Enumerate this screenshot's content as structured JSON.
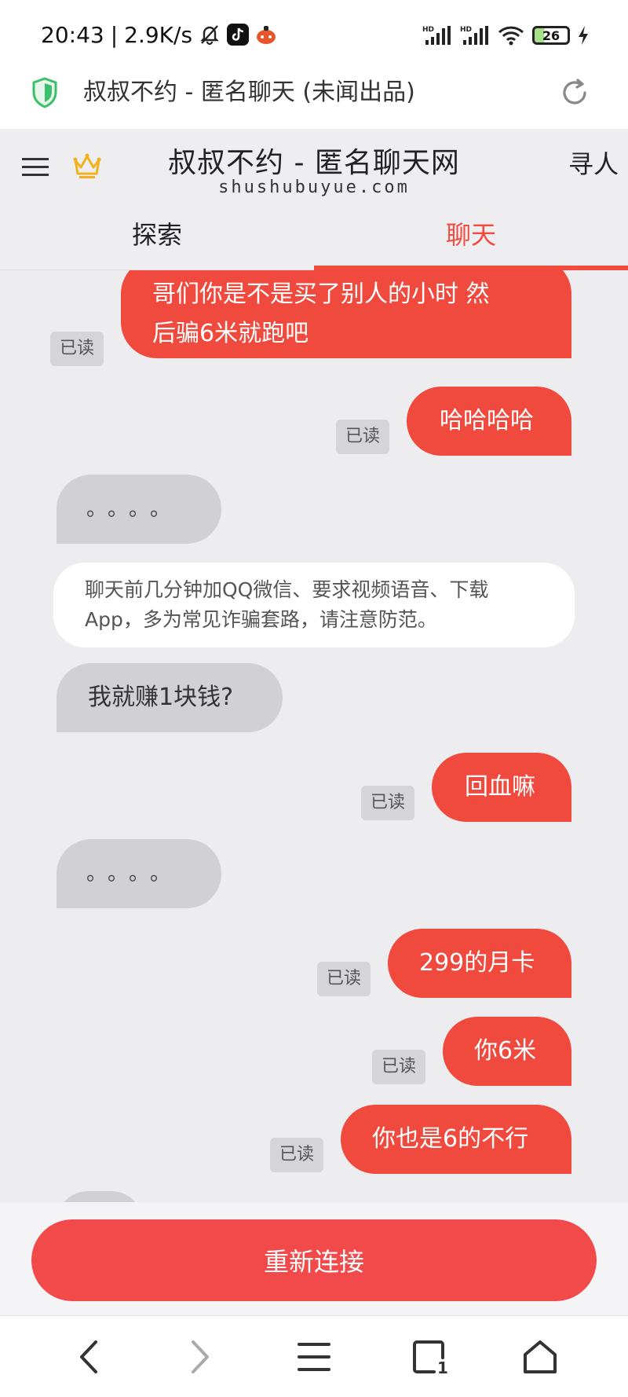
{
  "status_bar": {
    "time": "20:43",
    "separator": "|",
    "net_speed": "2.9K/s",
    "battery": "26",
    "icons": [
      "mute-bell-icon",
      "tiktok-icon",
      "app-icon",
      "hd-signal-icon",
      "hd-signal-icon",
      "wifi-icon",
      "battery-icon",
      "charging-icon"
    ]
  },
  "browser": {
    "title": "叔叔不约 - 匿名聊天 (未闻出品)",
    "icons": [
      "shield-icon",
      "reload-icon"
    ]
  },
  "site": {
    "title": "叔叔不约 - 匿名聊天网",
    "domain": "shushubuyue.com",
    "find_people": "寻人",
    "tabs": [
      {
        "label": "探索",
        "active": false
      },
      {
        "label": "聊天",
        "active": true
      }
    ],
    "accent": "#f24a3e",
    "crown_color": "#f2b21b"
  },
  "chat": {
    "read_label": "已读",
    "messages": [
      {
        "side": "out",
        "lines": [
          "哥们你是不是买了别人的小时 然",
          "后骗6米就跑吧"
        ],
        "read": true
      },
      {
        "side": "out",
        "lines": [
          "哈哈哈哈"
        ],
        "read": true
      },
      {
        "side": "in",
        "lines": [
          "。。。。"
        ]
      },
      {
        "side": "notice",
        "lines": [
          "聊天前几分钟加QQ微信、要求视频语音、下载",
          "App，多为常见诈骗套路，请注意防范。"
        ]
      },
      {
        "side": "in",
        "lines": [
          "我就赚1块钱?"
        ]
      },
      {
        "side": "out",
        "lines": [
          "回血嘛"
        ],
        "read": true
      },
      {
        "side": "in",
        "lines": [
          "。。。。"
        ]
      },
      {
        "side": "out",
        "lines": [
          "299的月卡"
        ],
        "read": true
      },
      {
        "side": "out",
        "lines": [
          "你6米"
        ],
        "read": true
      },
      {
        "side": "out",
        "lines": [
          "你也是6的不行"
        ],
        "read": true
      }
    ]
  },
  "bottom": {
    "reconnect_label": "重新连接"
  },
  "nav_bar": {
    "tab_count": "1",
    "icons": [
      "back-icon",
      "forward-icon",
      "menu-icon",
      "tabs-icon",
      "home-icon"
    ]
  }
}
